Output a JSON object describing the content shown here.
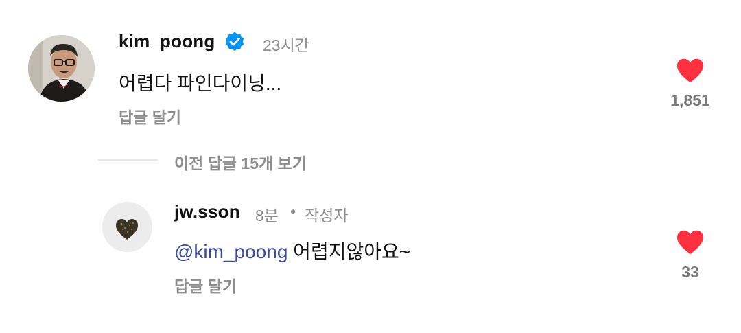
{
  "main_comment": {
    "username": "kim_poong",
    "verified": true,
    "time": "23시간",
    "text": "어렵다 파인다이닝...",
    "reply_label": "답글 달기",
    "likes": "1,851"
  },
  "view_previous_replies": "이전 답글 15개 보기",
  "reply_comment": {
    "username": "jw.sson",
    "time": "8분",
    "separator": "•",
    "author_badge": "작성자",
    "mention": "@kim_poong",
    "text": " 어렵지않아요~",
    "reply_label": "답글 달기",
    "likes": "33"
  },
  "colors": {
    "heart": "#ff3040",
    "verified": "#0095f6",
    "mention": "#3a4a9e",
    "muted": "#8e8e8e"
  }
}
